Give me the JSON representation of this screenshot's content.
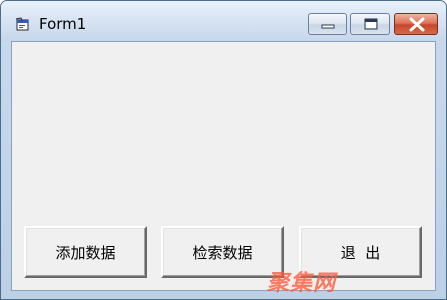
{
  "window": {
    "title": "Form1",
    "controls": {
      "minimize": "minimize-icon",
      "maximize": "maximize-icon",
      "close": "close-icon"
    }
  },
  "buttons": {
    "add_data": "添加数据",
    "search_data": "检索数据",
    "exit": "退  出"
  },
  "watermark": "聚集网",
  "colors": {
    "client_background": "#f0f0f0",
    "close_button": "#c7462b",
    "title_bar": "#d6e3f2",
    "watermark": "#ff5a3c"
  }
}
